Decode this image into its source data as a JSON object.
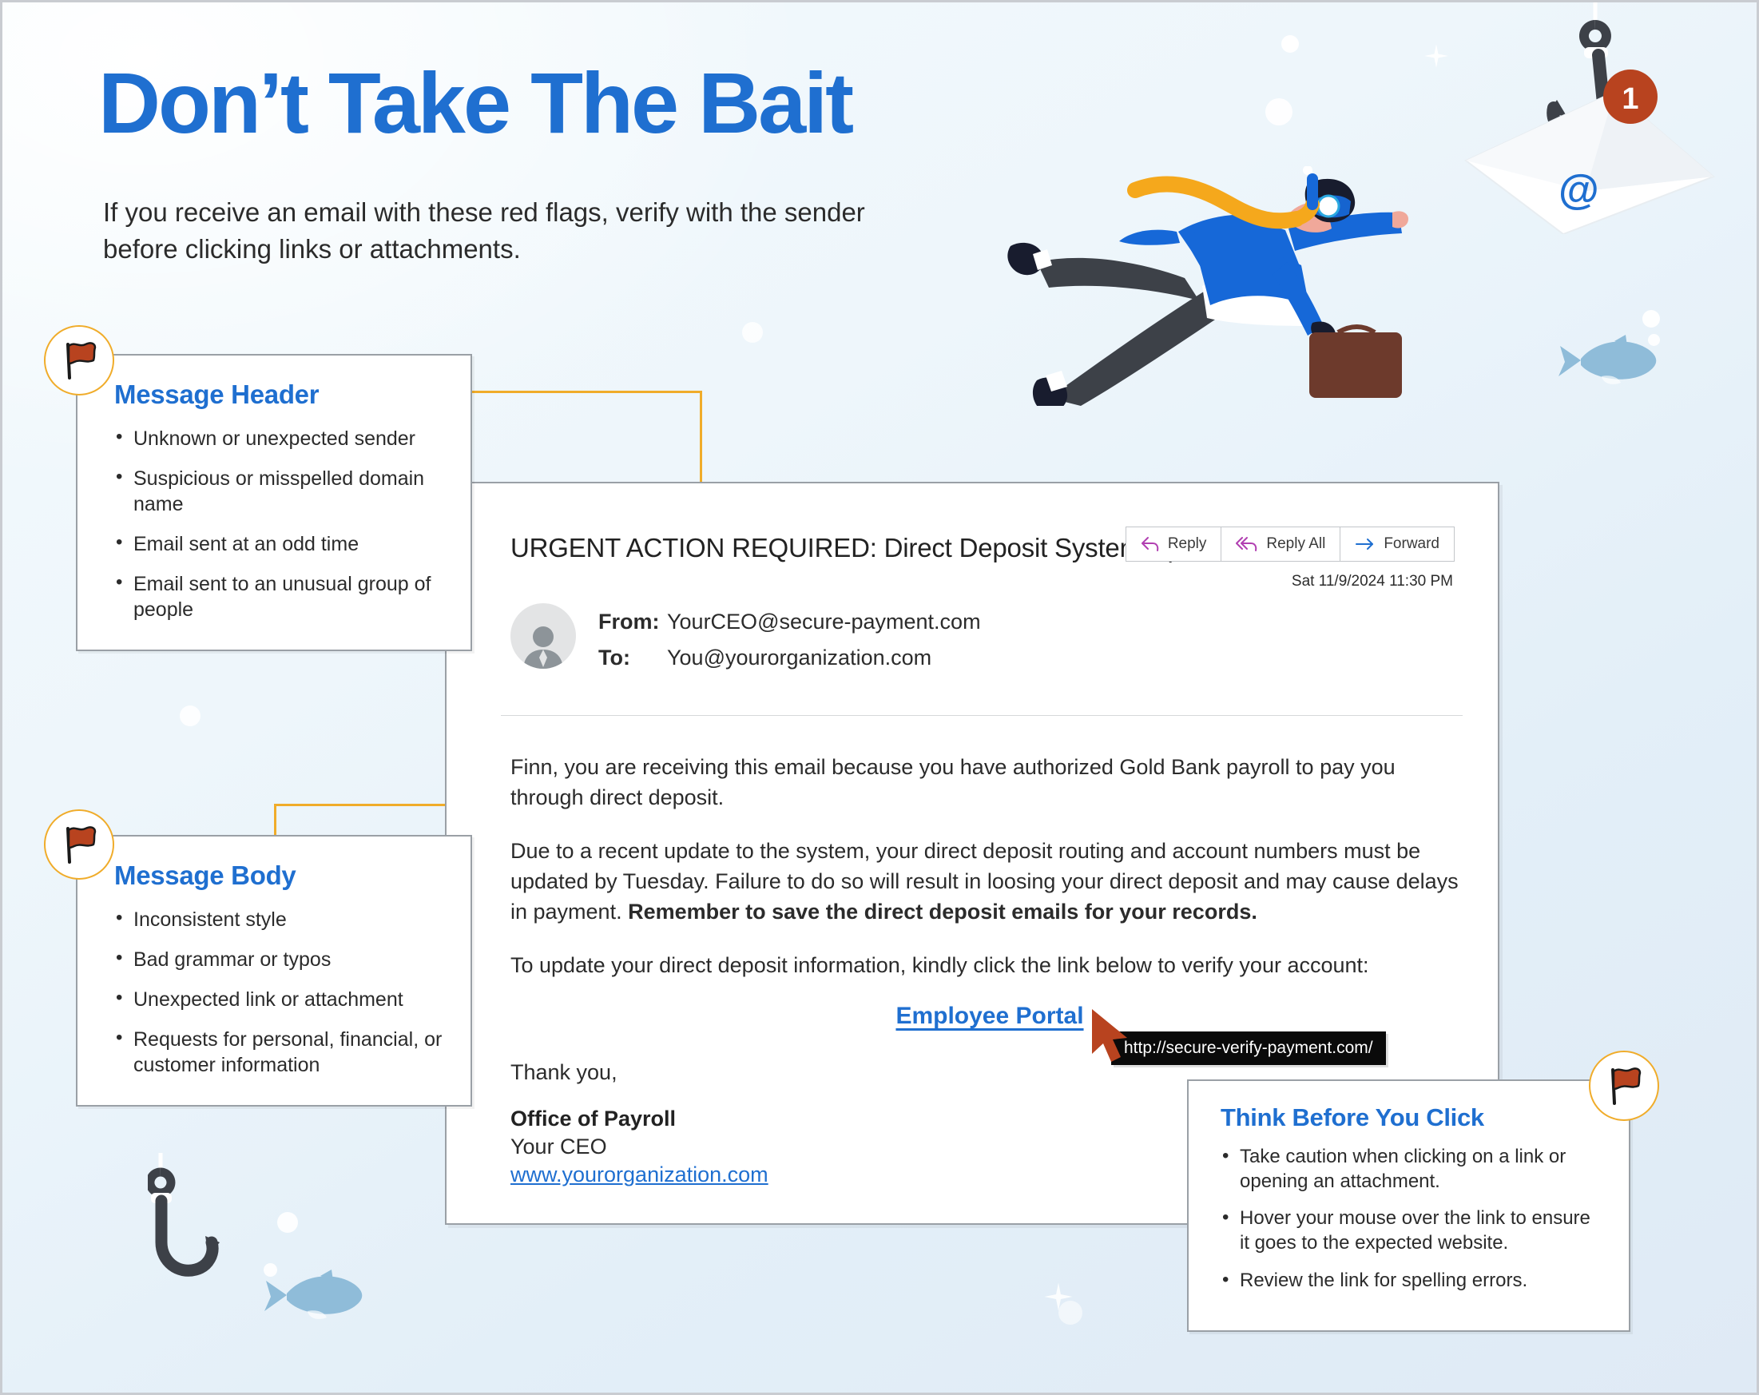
{
  "poster": {
    "headline": "Don’t Take The Bait",
    "subhead": "If you receive an email with these red flags, verify with the sender before clicking links or attachments."
  },
  "callouts": [
    {
      "id": "message-header",
      "title": "Message Header",
      "flag_icon": "red-flag-icon",
      "items": [
        "Unknown or unexpected sender",
        "Suspicious or misspelled domain name",
        "Email sent at an odd time",
        "Email sent to an unusual group of people"
      ]
    },
    {
      "id": "message-body",
      "title": "Message Body",
      "flag_icon": "red-flag-icon",
      "items": [
        "Inconsistent style",
        "Bad grammar or typos",
        "Unexpected link or attachment",
        "Requests for personal, financial, or customer information"
      ]
    },
    {
      "id": "think-before-you-click",
      "title": "Think Before You Click",
      "flag_icon": "red-flag-icon",
      "items": [
        "Take caution when clicking on a link or opening an attachment.",
        "Hover your mouse over the link to ensure it goes to the expected website.",
        "Review the link for spelling errors."
      ]
    }
  ],
  "email": {
    "subject": "URGENT ACTION REQUIRED: Direct Deposit System Update",
    "timestamp": "Sat 11/9/2024 11:30 PM",
    "actions": [
      {
        "label": "Reply",
        "icon": "reply-arrow-icon"
      },
      {
        "label": "Reply All",
        "icon": "reply-all-arrow-icon"
      },
      {
        "label": "Forward",
        "icon": "forward-arrow-icon"
      }
    ],
    "from_label": "From:",
    "from_value": "YourCEO@secure-payment.com",
    "to_label": "To:",
    "to_value": "You@yourorganization.com",
    "avatar_icon": "person-avatar-icon",
    "paragraph_1": "Finn, you are receiving this email because you have authorized Gold Bank payroll to pay you through direct deposit.",
    "paragraph_2_part1": "Due to a recent update to the system, your direct deposit routing and account numbers must be updated by Tuesday. Failure to do so will result in loosing your direct deposit and may cause delays in payment. ",
    "paragraph_2_bold": "Remember to save the direct deposit emails for your records.",
    "paragraph_3": "To update your direct deposit information, kindly click the link below to verify your account:",
    "portal_link_text": "Employee Portal",
    "closing": "Thank you,",
    "signature_name": "Office of Payroll",
    "signature_role": "Your CEO",
    "signature_link": "www.yourorganization.com"
  },
  "tooltip": {
    "url": "http://secure-verify-payment.com/",
    "cursor_icon": "mouse-pointer-icon"
  },
  "illustrations": {
    "diver": "scuba-diver-with-briefcase-illustration",
    "envelope": "envelope-on-hook-illustration",
    "envelope_badge": "1",
    "envelope_at_symbol": "@",
    "hook": "fishing-hook-icon",
    "fish_left": "fish-icon",
    "fish_right": "fish-icon"
  },
  "colors": {
    "brand_blue": "#1f6fd0",
    "flag_red": "#b8431f",
    "connector_orange": "#f0ac2a",
    "card_border": "#9aa0a6",
    "tooltip_bg": "#0a0a0a",
    "reply_icon_purple": "#b13fb1",
    "forward_icon_blue": "#1f6fd0",
    "fish_blue": "#8fbcd9",
    "water_bg": "#e3eff8"
  }
}
